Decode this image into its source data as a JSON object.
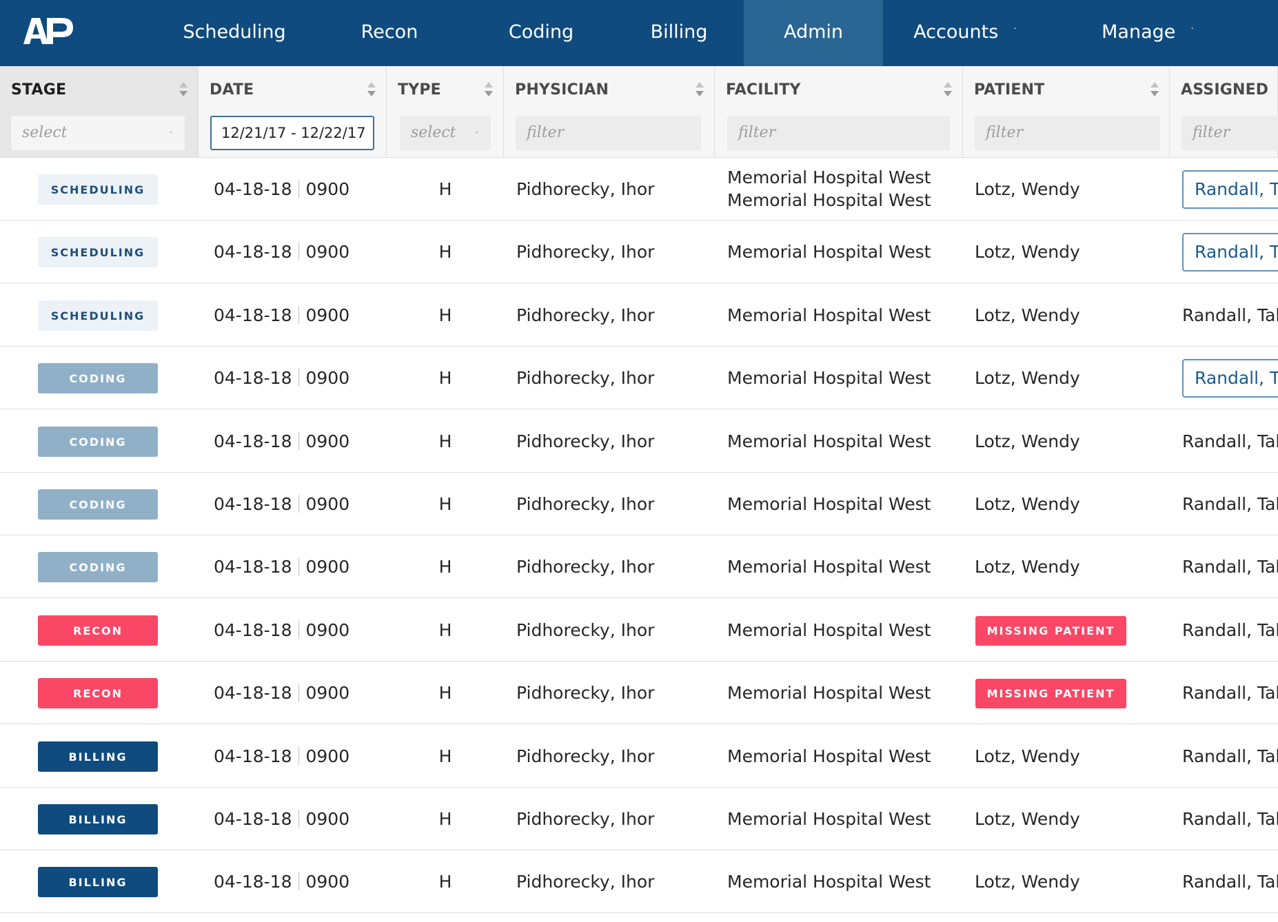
{
  "nav": {
    "logo_text": "AP",
    "items": [
      {
        "label": "Scheduling",
        "active": false
      },
      {
        "label": "Recon",
        "active": false
      },
      {
        "label": "Coding",
        "active": false
      },
      {
        "label": "Billing",
        "active": false
      },
      {
        "label": "Admin",
        "active": true
      },
      {
        "label": "Accounts",
        "active": false
      },
      {
        "label": "Manage",
        "active": false
      }
    ],
    "dropdown_caret": "·"
  },
  "table": {
    "columns": [
      {
        "label": "STAGE",
        "filter": "select"
      },
      {
        "label": "DATE",
        "filter": "12/21/17 - 12/22/17"
      },
      {
        "label": "TYPE",
        "filter": "select"
      },
      {
        "label": "PHYSICIAN",
        "filter": "filter"
      },
      {
        "label": "FACILITY",
        "filter": "filter"
      },
      {
        "label": "PATIENT",
        "filter": "filter"
      },
      {
        "label": "ASSIGNED",
        "filter": "filter"
      }
    ],
    "dropdown_caret": "·",
    "rows": [
      {
        "stage": "SCHEDULING",
        "date": "04-18-18",
        "time": "0900",
        "type": "H",
        "physician": "Pidhorecky, Ihor",
        "facility": "Memorial Hospital West",
        "facility2": "Memorial Hospital West",
        "patient": "Lotz, Wendy",
        "assigned": "Randall, Ta"
      },
      {
        "stage": "SCHEDULING",
        "date": "04-18-18",
        "time": "0900",
        "type": "H",
        "physician": "Pidhorecky, Ihor",
        "facility": "Memorial Hospital West",
        "patient": "Lotz, Wendy",
        "assigned": "Randall, Ta"
      },
      {
        "stage": "SCHEDULING",
        "date": "04-18-18",
        "time": "0900",
        "type": "H",
        "physician": "Pidhorecky, Ihor",
        "facility": "Memorial Hospital West",
        "patient": "Lotz, Wendy",
        "assigned": "Randall, Tah"
      },
      {
        "stage": "CODING",
        "date": "04-18-18",
        "time": "0900",
        "type": "H",
        "physician": "Pidhorecky, Ihor",
        "facility": "Memorial Hospital West",
        "patient": "Lotz, Wendy",
        "assigned": "Randall, Ta"
      },
      {
        "stage": "CODING",
        "date": "04-18-18",
        "time": "0900",
        "type": "H",
        "physician": "Pidhorecky, Ihor",
        "facility": "Memorial Hospital West",
        "patient": "Lotz, Wendy",
        "assigned": "Randall, Tah"
      },
      {
        "stage": "CODING",
        "date": "04-18-18",
        "time": "0900",
        "type": "H",
        "physician": "Pidhorecky, Ihor",
        "facility": "Memorial Hospital West",
        "patient": "Lotz, Wendy",
        "assigned": "Randall, Tah"
      },
      {
        "stage": "CODING",
        "date": "04-18-18",
        "time": "0900",
        "type": "H",
        "physician": "Pidhorecky, Ihor",
        "facility": "Memorial Hospital West",
        "patient": "Lotz, Wendy",
        "assigned": "Randall, Tah"
      },
      {
        "stage": "RECON",
        "date": "04-18-18",
        "time": "0900",
        "type": "H",
        "physician": "Pidhorecky, Ihor",
        "facility": "Memorial Hospital West",
        "patient": "MISSING PATIENT",
        "assigned": "Randall, Tah"
      },
      {
        "stage": "RECON",
        "date": "04-18-18",
        "time": "0900",
        "type": "H",
        "physician": "Pidhorecky, Ihor",
        "facility": "Memorial Hospital West",
        "patient": "MISSING PATIENT",
        "assigned": "Randall, Tah"
      },
      {
        "stage": "BILLING",
        "date": "04-18-18",
        "time": "0900",
        "type": "H",
        "physician": "Pidhorecky, Ihor",
        "facility": "Memorial Hospital West",
        "patient": "Lotz, Wendy",
        "assigned": "Randall, Tah"
      },
      {
        "stage": "BILLING",
        "date": "04-18-18",
        "time": "0900",
        "type": "H",
        "physician": "Pidhorecky, Ihor",
        "facility": "Memorial Hospital West",
        "patient": "Lotz, Wendy",
        "assigned": "Randall, Tah"
      },
      {
        "stage": "BILLING",
        "date": "04-18-18",
        "time": "0900",
        "type": "H",
        "physician": "Pidhorecky, Ihor",
        "facility": "Memorial Hospital West",
        "patient": "Lotz, Wendy",
        "assigned": "Randall, Tah"
      }
    ]
  },
  "colors": {
    "nav_bg": "#0f4b7e",
    "nav_active": "#2a6693",
    "scheduling": "#edf2f6",
    "coding": "#90b0c7",
    "recon": "#fb4766",
    "billing": "#0f4b7e",
    "assigned_button_border": "#5f93bb"
  },
  "icons": {
    "sort": "sort-arrows-icon",
    "dropdown": "dropdown-caret-icon"
  }
}
